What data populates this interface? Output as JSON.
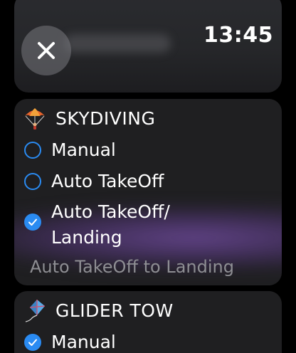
{
  "status": {
    "time": "13:45"
  },
  "close": {
    "icon": "close-icon"
  },
  "skydiving": {
    "title": "SKYDIVING",
    "icon": "parachute-icon",
    "options": [
      {
        "label": "Manual",
        "checked": false
      },
      {
        "label": "Auto TakeOff",
        "checked": false
      },
      {
        "label": "Auto TakeOff/\nLanding",
        "checked": true
      }
    ],
    "selected_description": "Auto TakeOff to Landing"
  },
  "glider_tow": {
    "title": "GLIDER TOW",
    "icon": "kite-icon",
    "options": [
      {
        "label": "Manual",
        "checked": true
      }
    ]
  },
  "colors": {
    "accent": "#2a8bf2",
    "card": "#1f1f21",
    "secondary_text": "#8e8e93"
  }
}
